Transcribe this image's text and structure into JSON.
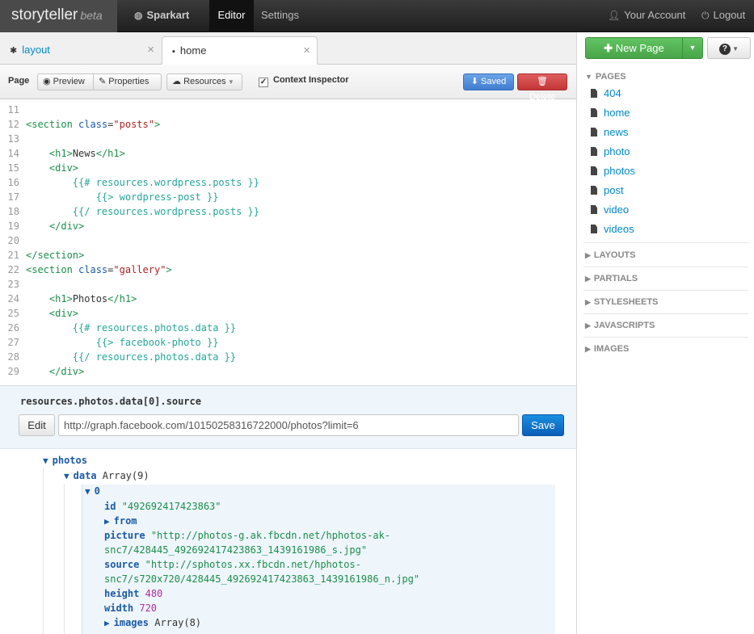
{
  "topbar": {
    "brand": "storyteller",
    "brand_suffix": "beta",
    "org": "Sparkart",
    "editor": "Editor",
    "settings": "Settings",
    "account": "Your Account",
    "logout": "Logout"
  },
  "tabs": [
    {
      "label": "layout",
      "close": "×"
    },
    {
      "label": "home",
      "close": "×"
    }
  ],
  "toolbar": {
    "page_label": "Page",
    "preview": "Preview",
    "properties": "Properties",
    "resources": "Resources",
    "context_inspector": "Context Inspector",
    "saved": "Saved",
    "delete": "Delete"
  },
  "code": {
    "line_numbers": [
      "11",
      "12",
      "13",
      "14",
      "15",
      "16",
      "17",
      "18",
      "19",
      "20",
      "21",
      "22",
      "23",
      "24",
      "25",
      "26",
      "27",
      "28",
      "29"
    ],
    "l12_open": "<section ",
    "l12_attr": "class",
    "l12_eq": "=",
    "l12_val": "\"posts\"",
    "l12_close": ">",
    "l14_open": "<h1>",
    "l14_text": "News",
    "l14_close": "</h1>",
    "l15": "<div>",
    "l16": "{{# resources.wordpress.posts }}",
    "l17": "{{> wordpress-post }}",
    "l18": "{{/ resources.wordpress.posts }}",
    "l19": "</div>",
    "l21": "</section>",
    "l22_open": "<section ",
    "l22_attr": "class",
    "l22_eq": "=",
    "l22_val": "\"gallery\"",
    "l22_close": ">",
    "l24_open": "<h1>",
    "l24_text": "Photos",
    "l24_close": "</h1>",
    "l25": "<div>",
    "l26": "{{# resources.photos.data }}",
    "l27": "{{> facebook-photo }}",
    "l28": "{{/ resources.photos.data }}",
    "l29": "</div>"
  },
  "inspector": {
    "path": "resources.photos.data[0].source",
    "edit": "Edit",
    "url": "http://graph.facebook.com/10150258316722000/photos?limit=6",
    "save": "Save"
  },
  "tree": {
    "photos": "photos",
    "data": "data",
    "data_type": "Array(9)",
    "index0": "0",
    "id_key": "id",
    "id_val": "\"492692417423863\"",
    "from_key": "from",
    "picture_key": "picture",
    "picture_val_1": "\"http://photos-g.ak.fbcdn.net/hphotos-ak-",
    "picture_val_2": "snc7/428445_492692417423863_1439161986_s.jpg\"",
    "source_key": "source",
    "source_val_1": "\"http://sphotos.xx.fbcdn.net/hphotos-",
    "source_val_2": "snc7/s720x720/428445_492692417423863_1439161986_n.jpg\"",
    "height_key": "height",
    "height_val": "480",
    "width_key": "width",
    "width_val": "720",
    "images_key": "images",
    "images_type": "Array(8)"
  },
  "sidebar": {
    "new_page": "New Page",
    "help": "?",
    "pages_label": "PAGES",
    "pages": [
      "404",
      "home",
      "news",
      "photo",
      "photos",
      "post",
      "video",
      "videos"
    ],
    "layouts": "LAYOUTS",
    "partials": "PARTIALS",
    "stylesheets": "STYLESHEETS",
    "javascripts": "JAVASCRIPTS",
    "images": "IMAGES"
  }
}
